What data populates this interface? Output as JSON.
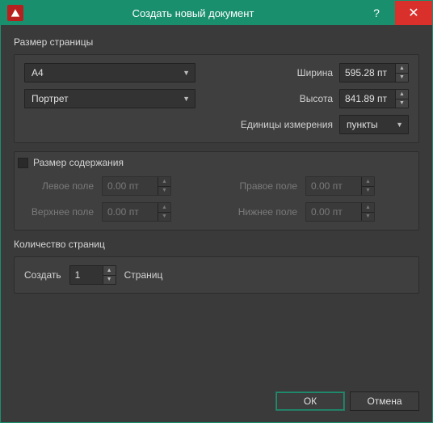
{
  "window": {
    "title": "Создать новый документ"
  },
  "pageSize": {
    "section_label": "Размер страницы",
    "preset": "A4",
    "orientation": "Портрет",
    "width_label": "Ширина",
    "width_value": "595.28 пт",
    "height_label": "Высота",
    "height_value": "841.89 пт",
    "units_label": "Единицы измерения",
    "units_value": "пункты"
  },
  "content": {
    "section_label": "Размер содержания",
    "left_label": "Левое поле",
    "left_value": "0.00 пт",
    "top_label": "Верхнее поле",
    "top_value": "0.00 пт",
    "right_label": "Правое поле",
    "right_value": "0.00 пт",
    "bottom_label": "Нижнее поле",
    "bottom_value": "0.00 пт"
  },
  "pages": {
    "section_label": "Количество страниц",
    "create_label": "Создать",
    "count_value": "1",
    "suffix_label": "Страниц"
  },
  "footer": {
    "ok": "ОК",
    "cancel": "Отмена"
  }
}
